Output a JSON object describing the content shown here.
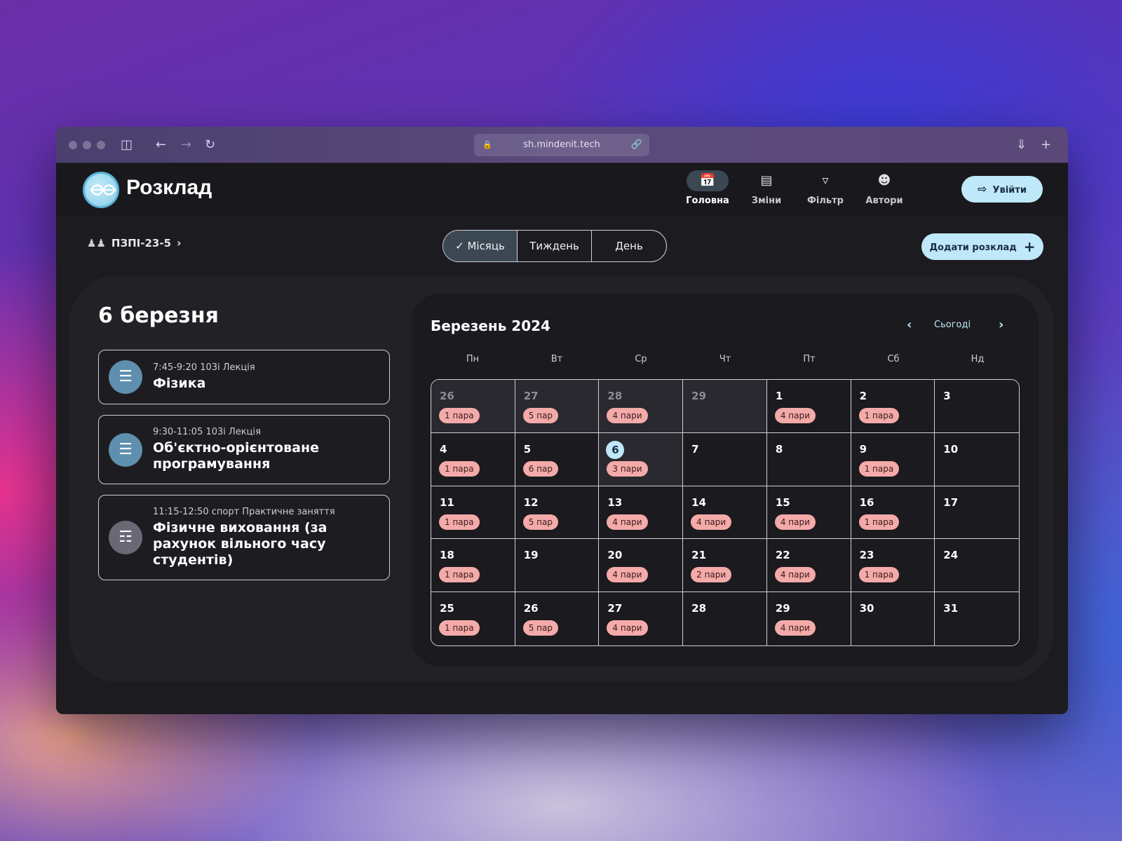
{
  "browser": {
    "url": "sh.mindenit.tech"
  },
  "header": {
    "brand": "Розклад",
    "nav": [
      {
        "label": "Головна",
        "icon": "calendar-icon",
        "active": true
      },
      {
        "label": "Зміни",
        "icon": "notes-icon",
        "active": false
      },
      {
        "label": "Фільтр",
        "icon": "filter-icon",
        "active": false
      },
      {
        "label": "Автори",
        "icon": "users-icon",
        "active": false
      }
    ],
    "login_label": "Увійти"
  },
  "toolbar": {
    "group_label": "ПЗПІ-23-5",
    "views": [
      "Місяць",
      "Тиждень",
      "День"
    ],
    "active_view": "Місяць",
    "add_label": "Додати розклад"
  },
  "day": {
    "title": "6 березня",
    "lessons": [
      {
        "meta": "7:45-9:20 103і Лекція",
        "name": "Фізика",
        "icon": "book-list-icon"
      },
      {
        "meta": "9:30-11:05 103і Лекція",
        "name": "Об'єктно-орієнтоване програмування",
        "icon": "book-list-icon"
      },
      {
        "meta": "11:15-12:50 спорт Практичне заняття",
        "name": "Фізичне виховання (за рахунок вільного часу студентів)",
        "icon": "open-book-icon"
      }
    ]
  },
  "calendar": {
    "title": "Березень 2024",
    "today_label": "Сьогоді",
    "weekdays": [
      "Пн",
      "Вт",
      "Ср",
      "Чт",
      "Пт",
      "Сб",
      "Нд"
    ],
    "cells": [
      {
        "d": "26",
        "b": "1 пара",
        "out": true
      },
      {
        "d": "27",
        "b": "5 пар",
        "out": true
      },
      {
        "d": "28",
        "b": "4 пари",
        "out": true
      },
      {
        "d": "29",
        "b": "",
        "out": true
      },
      {
        "d": "1",
        "b": "4 пари"
      },
      {
        "d": "2",
        "b": "1 пара"
      },
      {
        "d": "3",
        "b": ""
      },
      {
        "d": "4",
        "b": "1 пара"
      },
      {
        "d": "5",
        "b": "6 пар"
      },
      {
        "d": "6",
        "b": "3 пари",
        "sel": true
      },
      {
        "d": "7",
        "b": ""
      },
      {
        "d": "8",
        "b": ""
      },
      {
        "d": "9",
        "b": "1 пара"
      },
      {
        "d": "10",
        "b": ""
      },
      {
        "d": "11",
        "b": "1 пара"
      },
      {
        "d": "12",
        "b": "5 пар"
      },
      {
        "d": "13",
        "b": "4 пари"
      },
      {
        "d": "14",
        "b": "4 пари"
      },
      {
        "d": "15",
        "b": "4 пари"
      },
      {
        "d": "16",
        "b": "1 пара"
      },
      {
        "d": "17",
        "b": ""
      },
      {
        "d": "18",
        "b": "1 пара"
      },
      {
        "d": "19",
        "b": ""
      },
      {
        "d": "20",
        "b": "4 пари"
      },
      {
        "d": "21",
        "b": "2 пари"
      },
      {
        "d": "22",
        "b": "4 пари"
      },
      {
        "d": "23",
        "b": "1 пара"
      },
      {
        "d": "24",
        "b": ""
      },
      {
        "d": "25",
        "b": "1 пара"
      },
      {
        "d": "26",
        "b": "5 пар"
      },
      {
        "d": "27",
        "b": "4 пари"
      },
      {
        "d": "28",
        "b": ""
      },
      {
        "d": "29",
        "b": "4 пари"
      },
      {
        "d": "30",
        "b": ""
      },
      {
        "d": "31",
        "b": ""
      }
    ]
  },
  "colors": {
    "accent": "#bfe8f8",
    "badge": "#f3aaa8",
    "active_bg": "#3b4752"
  }
}
